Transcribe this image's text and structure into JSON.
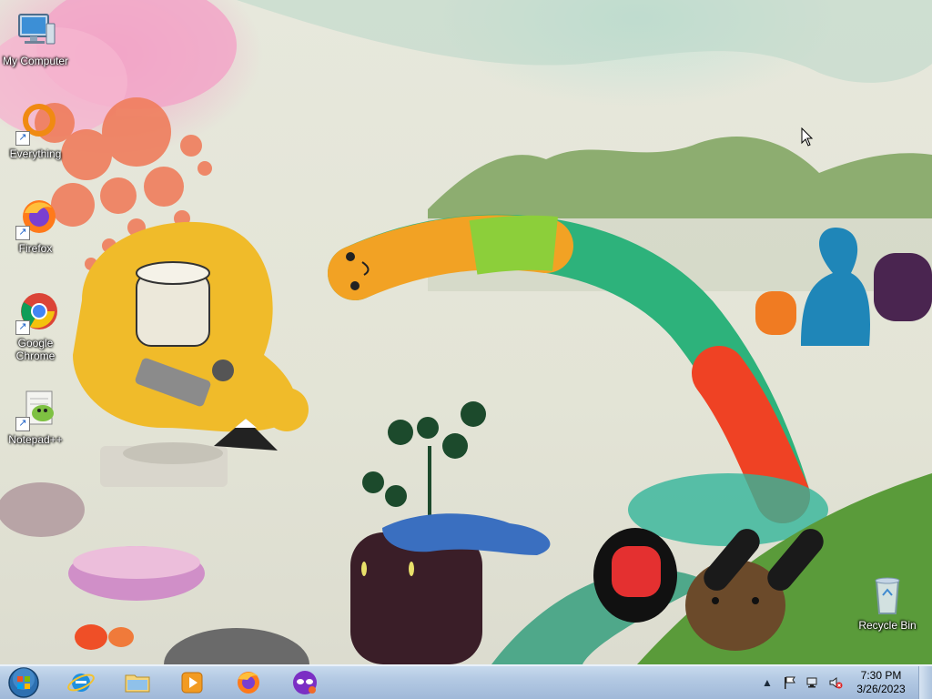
{
  "desktop": {
    "icons": [
      {
        "label": "My Computer",
        "icon": "computer-icon",
        "shortcut": false
      },
      {
        "label": "Everything",
        "icon": "everything-icon",
        "shortcut": true
      },
      {
        "label": "Firefox",
        "icon": "firefox-icon",
        "shortcut": true
      },
      {
        "label": "Google Chrome",
        "icon": "chrome-icon",
        "shortcut": true
      },
      {
        "label": "Notepad++",
        "icon": "notepadpp-icon",
        "shortcut": true
      },
      {
        "label": "Recycle Bin",
        "icon": "recycle-bin-icon",
        "shortcut": false
      }
    ]
  },
  "taskbar": {
    "start_icon": "windows-start-orb",
    "pinned": [
      {
        "name": "Internet Explorer",
        "icon": "internet-explorer-icon"
      },
      {
        "name": "Windows Explorer",
        "icon": "file-explorer-icon"
      },
      {
        "name": "Windows Media Player",
        "icon": "media-player-icon"
      },
      {
        "name": "Firefox",
        "icon": "firefox-icon"
      },
      {
        "name": "App",
        "icon": "purple-mask-icon"
      }
    ],
    "tray": {
      "show_hidden": "▲",
      "icons": [
        "action-center-flag-icon",
        "network-icon",
        "volume-muted-icon"
      ],
      "time": "7:30 PM",
      "date": "3/26/2023"
    }
  },
  "colors": {
    "taskbar": "#b3c9e3",
    "wallpaper_bg": "#e3e4d6"
  }
}
